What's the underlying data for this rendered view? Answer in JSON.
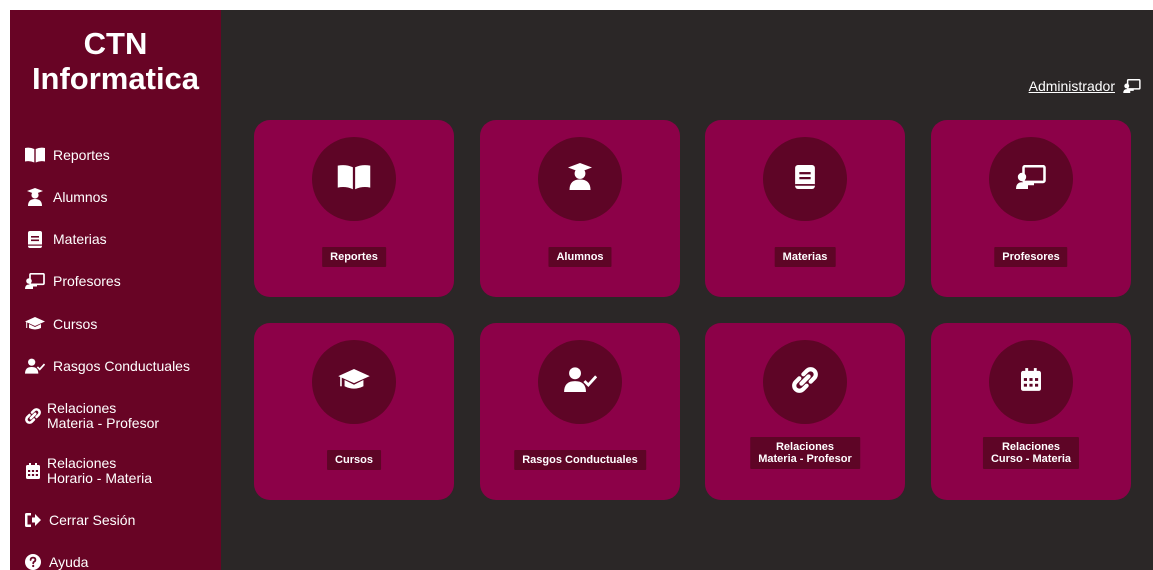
{
  "brand": {
    "line1": "CTN",
    "line2": "Informatica"
  },
  "user": {
    "name": "Administrador"
  },
  "sidebar": {
    "items": [
      {
        "label": "Reportes"
      },
      {
        "label": "Alumnos"
      },
      {
        "label": "Materias"
      },
      {
        "label": "Profesores"
      },
      {
        "label": "Cursos"
      },
      {
        "label": "Rasgos Conductuales"
      },
      {
        "line1": "Relaciones",
        "line2": "Materia - Profesor"
      },
      {
        "line1": "Relaciones",
        "line2": "Horario - Materia"
      },
      {
        "label": "Cerrar Sesión"
      },
      {
        "label": "Ayuda"
      }
    ]
  },
  "cards": [
    {
      "label": "Reportes",
      "icon": "book-open-icon"
    },
    {
      "label": "Alumnos",
      "icon": "user-graduate-icon"
    },
    {
      "label": "Materias",
      "icon": "book-icon"
    },
    {
      "label": "Profesores",
      "icon": "chalkboard-teacher-icon"
    },
    {
      "label": "Cursos",
      "icon": "graduation-cap-icon"
    },
    {
      "label": "Rasgos Conductuales",
      "icon": "user-check-icon"
    },
    {
      "line1": "Relaciones",
      "line2": "Materia - Profesor",
      "icon": "link-icon"
    },
    {
      "line1": "Relaciones",
      "line2": "Curso - Materia",
      "icon": "calendar-icon"
    }
  ],
  "colors": {
    "sidebar": "#680425",
    "background": "#2b2727",
    "card": "#8c0148",
    "card_circle": "#5e0526",
    "text": "#ffffff"
  }
}
